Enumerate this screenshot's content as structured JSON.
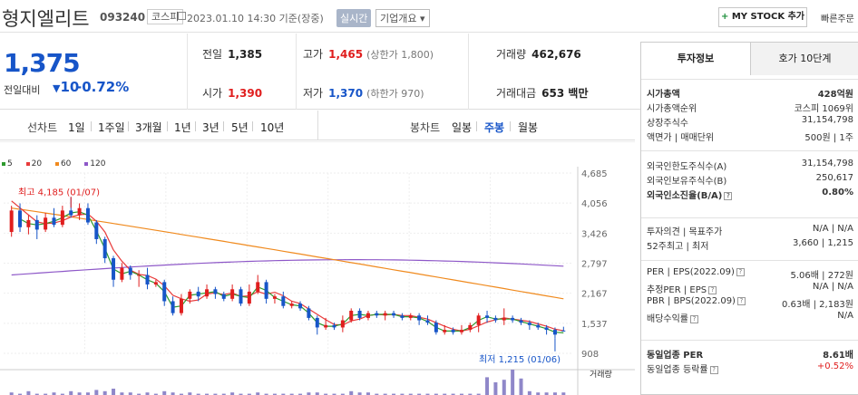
{
  "header": {
    "stock_name": "형지엘리트",
    "stock_code": "093240",
    "market": "코스피",
    "datetime": "2023.01.10 14:30 기준(장중)",
    "realtime_badge": "실시간",
    "company_info": "기업개요",
    "mystock_button": "MY STOCK 추가",
    "quick_order": "빠른주문"
  },
  "price": {
    "current": "1,375",
    "change_label": "전일대비",
    "change": "10",
    "change_pct": "-0.72%",
    "prev_close_label": "전일",
    "prev_close": "1,385",
    "open_label": "시가",
    "open": "1,390",
    "high_label": "고가",
    "high": "1,465",
    "upper_limit": "(상한가 1,800)",
    "low_label": "저가",
    "low": "1,370",
    "lower_limit": "(하한가 970)",
    "volume_label": "거래량",
    "volume": "462,676",
    "amount_label": "거래대금",
    "amount": "653 백만"
  },
  "tabs": {
    "line_label": "선차트",
    "line_items": [
      "1일",
      "1주일",
      "3개월",
      "1년",
      "3년",
      "5년",
      "10년"
    ],
    "candle_label": "봉차트",
    "candle_items": [
      "일봉",
      "주봉",
      "월봉"
    ],
    "active_candle": "주봉"
  },
  "chart_data": {
    "type": "candlestick",
    "legend": [
      {
        "name": "5",
        "color": "#2e9a2e"
      },
      {
        "name": "20",
        "color": "#e83a3a"
      },
      {
        "name": "60",
        "color": "#f08a1e"
      },
      {
        "name": "120",
        "color": "#8e58c8"
      }
    ],
    "y_ticks": [
      4685,
      4056,
      3426,
      2797,
      2167,
      1537,
      908
    ],
    "ylim": [
      908,
      4685
    ],
    "high_annotation": "최고 4,185 (01/07)",
    "low_annotation": "최저 1,215 (01/06)",
    "volume_label": "거래량",
    "candles": [
      [
        3450,
        3900,
        3350,
        4000
      ],
      [
        3900,
        3550,
        3450,
        4050
      ],
      [
        3550,
        3700,
        3400,
        3800
      ],
      [
        3700,
        3500,
        3300,
        3800
      ],
      [
        3500,
        3750,
        3450,
        3850
      ],
      [
        3750,
        3600,
        3550,
        3950
      ],
      [
        3600,
        3900,
        3550,
        4000
      ],
      [
        3900,
        3800,
        3750,
        4185
      ],
      [
        3800,
        3950,
        3700,
        4050
      ],
      [
        3950,
        3650,
        3600,
        4050
      ],
      [
        3650,
        3300,
        3200,
        3700
      ],
      [
        3300,
        2900,
        2800,
        3350
      ],
      [
        2900,
        2450,
        2300,
        2950
      ],
      [
        2450,
        2700,
        2400,
        2800
      ],
      [
        2700,
        2550,
        2450,
        2750
      ],
      [
        2550,
        2550,
        2300,
        2650
      ],
      [
        2550,
        2350,
        2250,
        2700
      ],
      [
        2350,
        2400,
        2300,
        2450
      ],
      [
        2400,
        2000,
        1900,
        2450
      ],
      [
        2000,
        1750,
        1700,
        2100
      ],
      [
        1750,
        2050,
        1700,
        2150
      ],
      [
        2050,
        2200,
        1950,
        2250
      ],
      [
        2200,
        2100,
        2000,
        2300
      ],
      [
        2100,
        2250,
        2050,
        2350
      ],
      [
        2250,
        2150,
        2050,
        2300
      ],
      [
        2150,
        2050,
        2000,
        2200
      ],
      [
        2050,
        2250,
        2000,
        2350
      ],
      [
        2250,
        1950,
        1900,
        2300
      ],
      [
        1950,
        2200,
        1900,
        2350
      ],
      [
        2200,
        2400,
        2150,
        2550
      ],
      [
        2400,
        2050,
        1950,
        2450
      ],
      [
        2050,
        2100,
        1950,
        2150
      ],
      [
        2100,
        1900,
        1850,
        2200
      ],
      [
        1900,
        1950,
        1850,
        2000
      ],
      [
        1950,
        1850,
        1800,
        2000
      ],
      [
        1850,
        1650,
        1600,
        1900
      ],
      [
        1650,
        1450,
        1300,
        1700
      ],
      [
        1450,
        1500,
        1400,
        1650
      ],
      [
        1500,
        1450,
        1400,
        1550
      ],
      [
        1450,
        1600,
        1350,
        1700
      ],
      [
        1600,
        1800,
        1550,
        1850
      ],
      [
        1800,
        1650,
        1600,
        1850
      ],
      [
        1650,
        1750,
        1600,
        1800
      ],
      [
        1750,
        1700,
        1650,
        1800
      ],
      [
        1700,
        1750,
        1600,
        1800
      ],
      [
        1750,
        1700,
        1650,
        1800
      ],
      [
        1700,
        1650,
        1600,
        1750
      ],
      [
        1650,
        1700,
        1600,
        1750
      ],
      [
        1700,
        1600,
        1500,
        1750
      ],
      [
        1600,
        1550,
        1500,
        1700
      ],
      [
        1550,
        1350,
        1300,
        1600
      ],
      [
        1350,
        1400,
        1300,
        1500
      ],
      [
        1400,
        1350,
        1300,
        1450
      ],
      [
        1350,
        1400,
        1300,
        1500
      ],
      [
        1400,
        1500,
        1350,
        1550
      ],
      [
        1500,
        1700,
        1350,
        1750
      ],
      [
        1700,
        1650,
        1550,
        1800
      ],
      [
        1650,
        1600,
        1550,
        1700
      ],
      [
        1600,
        1650,
        1500,
        1850
      ],
      [
        1650,
        1600,
        1550,
        1700
      ],
      [
        1600,
        1550,
        1500,
        1650
      ],
      [
        1550,
        1500,
        1400,
        1600
      ],
      [
        1500,
        1450,
        1400,
        1550
      ],
      [
        1450,
        1400,
        1300,
        1500
      ],
      [
        1400,
        1300,
        1215,
        1450
      ],
      [
        1385,
        1375,
        1370,
        1465
      ]
    ]
  },
  "panel": {
    "tab_info": "투자정보",
    "tab_orderbook": "호가 10단계",
    "rows": [
      {
        "label": "시가총액",
        "value": "428억원",
        "bold": true
      },
      {
        "label": "시가총액순위",
        "value": "코스피 1069위"
      },
      {
        "label": "상장주식수",
        "value": "31,154,798"
      },
      {
        "label": "액면가 | 매매단위",
        "value": "500원 | 1주"
      },
      {
        "label": "외국인한도주식수(A)",
        "value": "31,154,798"
      },
      {
        "label": "외국인보유주식수(B)",
        "value": "250,617"
      },
      {
        "label": "외국인소진율(B/A)",
        "value": "0.80%",
        "bold": true
      },
      {
        "label": "투자의견 | 목표주가",
        "value": "N/A | N/A"
      },
      {
        "label": "52주최고 | 최저",
        "value": "3,660 | 1,215"
      },
      {
        "label": "PER | EPS(2022.09)",
        "value": "5.06배 | 272원"
      },
      {
        "label": "추정PER | EPS",
        "value": "N/A | N/A"
      },
      {
        "label": "PBR | BPS(2022.09)",
        "value": "0.63배 | 2,183원"
      },
      {
        "label": "배당수익률",
        "value": "N/A"
      },
      {
        "label": "동일업종 PER",
        "value": "8.61배",
        "bold": true
      },
      {
        "label": "동일업종 등락률",
        "value": "+0.52%"
      }
    ]
  }
}
